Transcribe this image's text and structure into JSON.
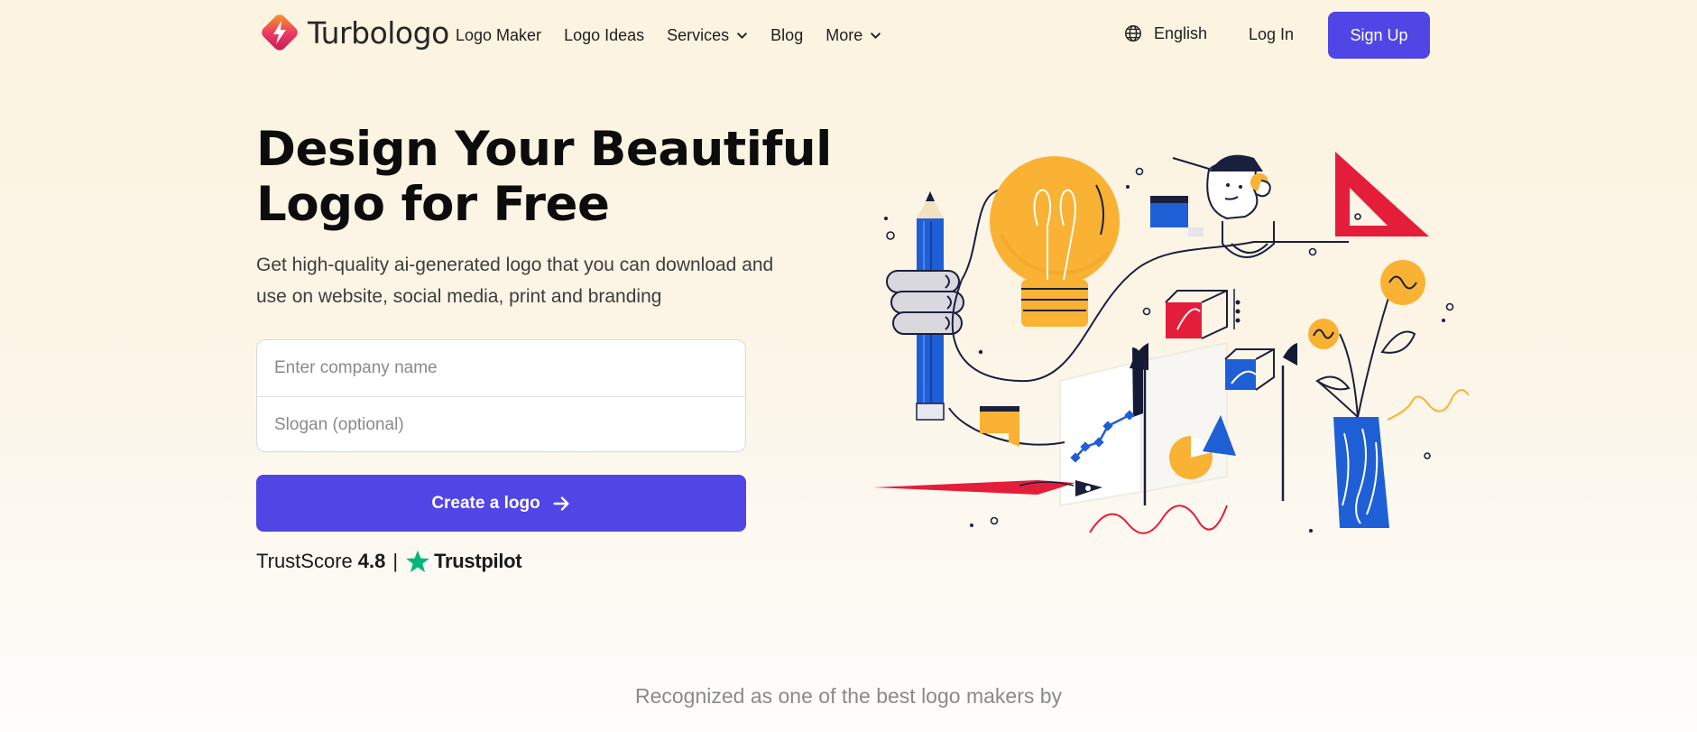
{
  "header": {
    "brand": "Turbologo",
    "nav": [
      {
        "label": "Logo Maker",
        "has_caret": false
      },
      {
        "label": "Logo Ideas",
        "has_caret": false
      },
      {
        "label": "Services",
        "has_caret": true
      },
      {
        "label": "Blog",
        "has_caret": false
      },
      {
        "label": "More",
        "has_caret": true
      }
    ],
    "language": "English",
    "login": "Log In",
    "signup": "Sign Up"
  },
  "hero": {
    "title_line1": "Design Your Beautiful",
    "title_line2": "Logo for Free",
    "subtitle_line1": "Get high-quality ai-generated logo that you can download and",
    "subtitle_line2": "use on website, social media, print and branding",
    "company_placeholder": "Enter company name",
    "slogan_placeholder": "Slogan (optional)",
    "cta": "Create a logo",
    "trust_label": "TrustScore",
    "trust_score": "4.8",
    "trust_separator": "|",
    "trustpilot": "Trustpilot"
  },
  "footer": {
    "recognized": "Recognized as one of the best logo makers by"
  },
  "colors": {
    "accent": "#5045e5",
    "trustpilot_green": "#00b67a",
    "yellow": "#f9b233",
    "red": "#e41e3a",
    "blue": "#1f5fd6",
    "navy": "#1a1f3d"
  },
  "icons": {
    "logo": "turbologo-diamond-icon",
    "caret": "chevron-down-icon",
    "language": "globe-icon",
    "cta": "arrow-right-icon",
    "trustpilot": "star-icon"
  }
}
